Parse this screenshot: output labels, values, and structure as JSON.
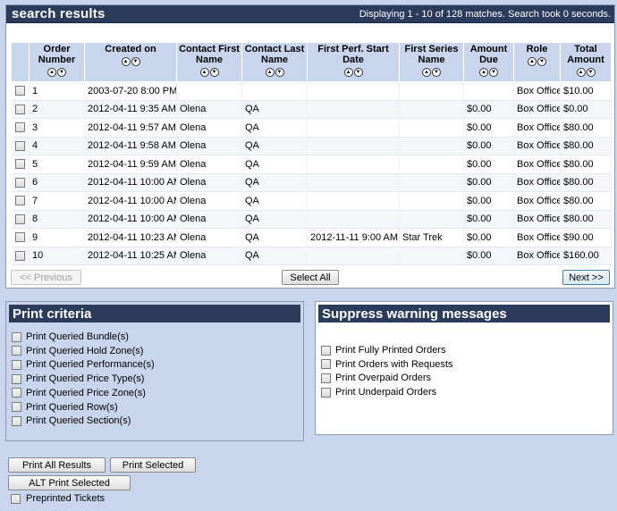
{
  "results": {
    "title": "search results",
    "status": "Displaying 1 - 10 of 128 matches. Search took 0 seconds.",
    "columns": [
      {
        "key": "order_number",
        "label": "Order Number"
      },
      {
        "key": "created_on",
        "label": "Created on"
      },
      {
        "key": "first_name",
        "label": "Contact First Name"
      },
      {
        "key": "last_name",
        "label": "Contact Last Name"
      },
      {
        "key": "first_perf",
        "label": "First Perf. Start Date"
      },
      {
        "key": "first_series",
        "label": "First Series Name"
      },
      {
        "key": "amount_due",
        "label": "Amount Due"
      },
      {
        "key": "role",
        "label": "Role"
      },
      {
        "key": "total_amount",
        "label": "Total Amount"
      }
    ],
    "rows": [
      {
        "order_number": "1",
        "created_on": "2003-07-20 8:00 PM",
        "first_name": "",
        "last_name": "",
        "first_perf": "",
        "first_series": "",
        "amount_due": "",
        "role": "Box Office",
        "total_amount": "$10.00"
      },
      {
        "order_number": "2",
        "created_on": "2012-04-11 9:35 AM",
        "first_name": "Olena",
        "last_name": "QA",
        "first_perf": "",
        "first_series": "",
        "amount_due": "$0.00",
        "role": "Box Office",
        "total_amount": "$0.00"
      },
      {
        "order_number": "3",
        "created_on": "2012-04-11 9:57 AM",
        "first_name": "Olena",
        "last_name": "QA",
        "first_perf": "",
        "first_series": "",
        "amount_due": "$0.00",
        "role": "Box Office",
        "total_amount": "$80.00"
      },
      {
        "order_number": "4",
        "created_on": "2012-04-11 9:58 AM",
        "first_name": "Olena",
        "last_name": "QA",
        "first_perf": "",
        "first_series": "",
        "amount_due": "$0.00",
        "role": "Box Office",
        "total_amount": "$80.00"
      },
      {
        "order_number": "5",
        "created_on": "2012-04-11 9:59 AM",
        "first_name": "Olena",
        "last_name": "QA",
        "first_perf": "",
        "first_series": "",
        "amount_due": "$0.00",
        "role": "Box Office",
        "total_amount": "$80.00"
      },
      {
        "order_number": "6",
        "created_on": "2012-04-11 10:00 AM",
        "first_name": "Olena",
        "last_name": "QA",
        "first_perf": "",
        "first_series": "",
        "amount_due": "$0.00",
        "role": "Box Office",
        "total_amount": "$80.00"
      },
      {
        "order_number": "7",
        "created_on": "2012-04-11 10:00 AM",
        "first_name": "Olena",
        "last_name": "QA",
        "first_perf": "",
        "first_series": "",
        "amount_due": "$0.00",
        "role": "Box Office",
        "total_amount": "$80.00"
      },
      {
        "order_number": "8",
        "created_on": "2012-04-11 10:00 AM",
        "first_name": "Olena",
        "last_name": "QA",
        "first_perf": "",
        "first_series": "",
        "amount_due": "$0.00",
        "role": "Box Office",
        "total_amount": "$80.00"
      },
      {
        "order_number": "9",
        "created_on": "2012-04-11 10:23 AM",
        "first_name": "Olena",
        "last_name": "QA",
        "first_perf": "2012-11-11 9:00 AM",
        "first_series": "Star Trek",
        "amount_due": "$0.00",
        "role": "Box Office",
        "total_amount": "$90.00"
      },
      {
        "order_number": "10",
        "created_on": "2012-04-11 10:25 AM",
        "first_name": "Olena",
        "last_name": "QA",
        "first_perf": "",
        "first_series": "",
        "amount_due": "$0.00",
        "role": "Box Office",
        "total_amount": "$160.00"
      }
    ],
    "sort_up_icon": "sort-ascending-icon",
    "sort_down_icon": "sort-descending-icon"
  },
  "pager": {
    "previous_label": "<< Previous",
    "select_all_label": "Select All",
    "next_label": "Next >>"
  },
  "print_criteria": {
    "title": "Print criteria",
    "options": [
      "Print Queried Bundle(s)",
      "Print Queried Hold Zone(s)",
      "Print Queried Performance(s)",
      "Print Queried Price Type(s)",
      "Print Queried Price Zone(s)",
      "Print Queried Row(s)",
      "Print Queried Section(s)"
    ]
  },
  "suppress_warnings": {
    "title": "Suppress warning messages",
    "options": [
      "Print Fully Printed Orders",
      "Print Orders with Requests",
      "Print Overpaid Orders",
      "Print Underpaid Orders"
    ]
  },
  "actions": {
    "print_all_label": "Print All Results",
    "print_selected_label": "Print Selected",
    "alt_print_selected_label": "ALT Print Selected",
    "preprinted_label": "Preprinted Tickets"
  },
  "colors": {
    "page_bg": "#c9d5ec",
    "header_bg": "#2b3b5c",
    "header_text": "#ffffff"
  }
}
